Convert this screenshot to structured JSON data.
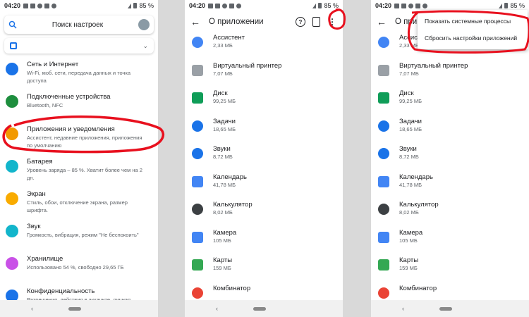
{
  "status": {
    "time": "04:20",
    "battery": "85 %"
  },
  "settings": {
    "search_label": "Поиск настроек",
    "items": [
      {
        "title": "Сеть и Интернет",
        "desc1": "Wi-Fi, моб. сети, передача данных и точка",
        "desc2": "доступа",
        "icon": "wifi-icon",
        "color": "#1a73e8"
      },
      {
        "title": "Подключенные устройства",
        "desc1": "Bluetooth, NFC",
        "desc2": "",
        "icon": "devices-icon",
        "color": "#1e8e3e"
      },
      {
        "title": "Приложения и уведомления",
        "desc1": "Ассистент, недавние приложения, приложения",
        "desc2": "по умолчанию",
        "icon": "apps-grid-icon",
        "color": "#f29900"
      },
      {
        "title": "Батарея",
        "desc1": "Уровень заряда – 85 %. Хватит более чем на 2",
        "desc2": "дн.",
        "icon": "battery-icon",
        "color": "#12b5cb"
      },
      {
        "title": "Экран",
        "desc1": "Стиль, обои, отключение экрана, размер",
        "desc2": "шрифта.",
        "icon": "brightness-icon",
        "color": "#f9ab00"
      },
      {
        "title": "Звук",
        "desc1": "Громкость, вибрация, режим \"Не беспокоить\"",
        "desc2": "",
        "icon": "volume-icon",
        "color": "#12b5cb"
      },
      {
        "title": "Хранилище",
        "desc1": "Использовано 54 %, свободно 29,65 ГБ",
        "desc2": "",
        "icon": "storage-icon",
        "color": "#c951e7"
      },
      {
        "title": "Конфиденциальность",
        "desc1": "Разрешения, действия в аккаунте, личная",
        "desc2": "",
        "icon": "privacy-icon",
        "color": "#1a73e8"
      }
    ]
  },
  "appinfo": {
    "title": "О приложении",
    "title_cut": "О при",
    "apps": [
      {
        "name": "Ассистент",
        "size": "2,33 МБ",
        "icon": "assistant-icon",
        "color": "#4285f4",
        "shape": "round"
      },
      {
        "name": "Виртуальный принтер",
        "size": "7,07 МБ",
        "icon": "printer-icon",
        "color": "#9aa0a6",
        "shape": "sq"
      },
      {
        "name": "Диск",
        "size": "99,25 МБ",
        "icon": "drive-icon",
        "color": "#0f9d58",
        "shape": "sq"
      },
      {
        "name": "Задачи",
        "size": "18,65 МБ",
        "icon": "tasks-icon",
        "color": "#1a73e8",
        "shape": "round"
      },
      {
        "name": "Звуки",
        "size": "8,72 МБ",
        "icon": "sounds-icon",
        "color": "#1a73e8",
        "shape": "round"
      },
      {
        "name": "Календарь",
        "size": "41,78 МБ",
        "icon": "calendar-icon",
        "color": "#4285f4",
        "shape": "sq"
      },
      {
        "name": "Калькулятор",
        "size": "8,02 МБ",
        "icon": "calculator-icon",
        "color": "#3c4043",
        "shape": "round"
      },
      {
        "name": "Камера",
        "size": "105 МБ",
        "icon": "camera-icon",
        "color": "#4285f4",
        "shape": "sq"
      },
      {
        "name": "Карты",
        "size": "159 МБ",
        "icon": "maps-icon",
        "color": "#34a853",
        "shape": "sq"
      },
      {
        "name": "Комбинатор",
        "size": "",
        "icon": "combinator-icon",
        "color": "#ea4335",
        "shape": "round"
      }
    ]
  },
  "menu": {
    "show_system": "Показать системные процессы",
    "reset_prefs": "Сбросить настройки приложений"
  },
  "colors": {
    "annotation": "#e8101e"
  }
}
